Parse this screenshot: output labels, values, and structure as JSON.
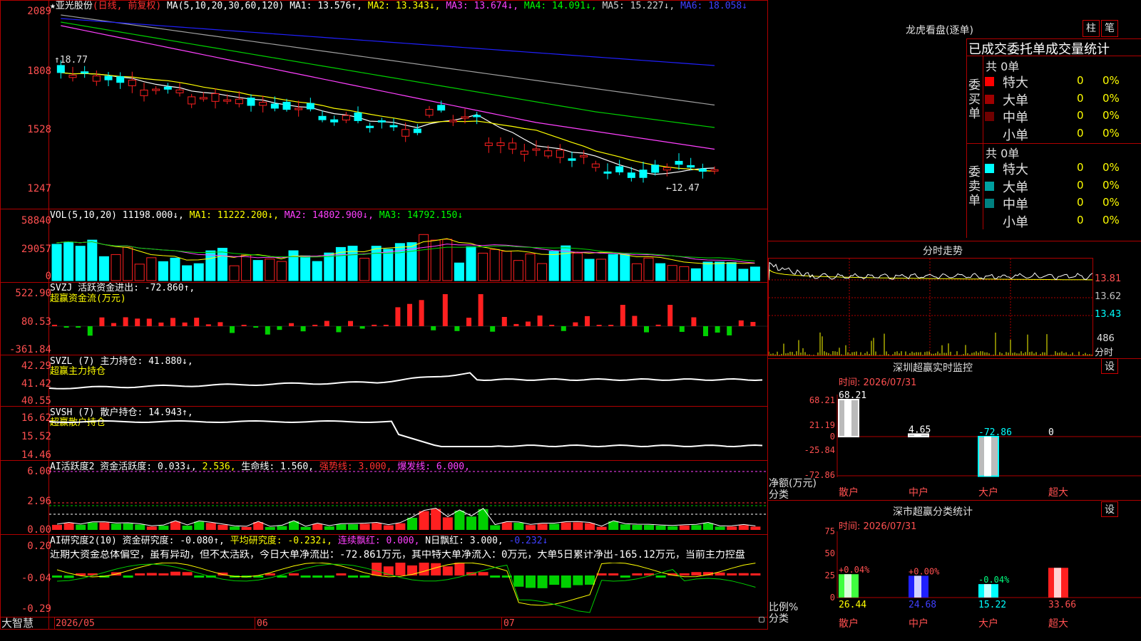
{
  "colors": {
    "up": "#ff2020",
    "down": "#00ffff",
    "frame": "#b00000",
    "axis_text": "#ff5050",
    "yellow": "#ffff00",
    "magenta": "#ff40ff",
    "green": "#00d000",
    "blue": "#2020ff",
    "white": "#ffffff",
    "gray": "#a0a0a0"
  },
  "kline": {
    "title_star": "★",
    "stock_name": "亚光股份",
    "mode": "(日线, 前复权)",
    "ma_def": "MA(5,10,20,30,60,120)",
    "ma1": "MA1: 13.576↑,",
    "ma2": "MA2: 13.343↓,",
    "ma3": "MA3: 13.674↓,",
    "ma4": "MA4: 14.091↓,",
    "ma5": "MA5: 15.227↓,",
    "ma6": "MA6: 18.058↓",
    "axis": [
      "2089",
      "1808",
      "1528",
      "1247"
    ],
    "high_mark": "18.77",
    "low_mark": "12.47"
  },
  "vol": {
    "label": "VOL(5,10,20)",
    "value": "11198.000↓,",
    "ma1": "MA1: 11222.200↓,",
    "ma2": "MA2: 14802.900↓,",
    "ma3": "MA3: 14792.150↓",
    "axis": [
      "58840",
      "29057",
      "0"
    ]
  },
  "svzj": {
    "label": "SVZJ  活跃资金进出: -72.860↑,",
    "sub": "超赢资金流(万元)",
    "axis": [
      "522.90",
      "80.53",
      "-361.84"
    ]
  },
  "svzl": {
    "label": "SVZL (7) 主力持仓: 41.880↓,",
    "sub": "超赢主力持仓",
    "axis": [
      "42.29",
      "41.42",
      "40.55"
    ]
  },
  "svsh": {
    "label": "SVSH (7) 散户持仓: 14.943↑,",
    "sub": "超赢散户持仓",
    "axis": [
      "16.62",
      "15.52",
      "14.46"
    ]
  },
  "ai1": {
    "label": "AI活跃度2 资金活跃度: 0.033↓,",
    "v2": "2.536,",
    "life": "生命线: 1.560,",
    "strong": "强势线: 3.000,",
    "burst": "爆发线: 6.000,",
    "axis": [
      "6.00",
      "2.96",
      "0.00"
    ]
  },
  "ai2": {
    "label": "AI研究度2(10) 资金研究度: -0.080↑,",
    "avg": "平均研究度: -0.232↓,",
    "cont": "连续飘红: 0.000,",
    "nday": "N日飘红: 3.000,",
    "last": "-0.232↓",
    "note": "近期大资金总体偏空，虽有异动，但不太活跃，今日大单净流出：-72.861万元，其中特大单净流入：0万元，大单5日累计净出-165.12万元，当前主力控盘",
    "axis": [
      "0.20",
      "-0.04",
      "-0.29"
    ]
  },
  "bottom": {
    "brand": "大智慧",
    "dates": [
      "2026/05",
      "06",
      "07"
    ]
  },
  "right": {
    "dragon_title": "龙虎看盘(逐单)",
    "btn_a": "柱",
    "btn_b": "笔",
    "tabs": "已成交委托单成交量统计",
    "buy_label": "委买单",
    "buy_total": "共 0单",
    "sell_label": "委卖单",
    "sell_total": "共 0单",
    "buy_rows": [
      {
        "name": "特大",
        "v": "0",
        "p": "0%",
        "c": "#ff0000"
      },
      {
        "name": "大单",
        "v": "0",
        "p": "0%",
        "c": "#a00000"
      },
      {
        "name": "中单",
        "v": "0",
        "p": "0%",
        "c": "#700000"
      },
      {
        "name": "小单",
        "v": "0",
        "p": "0%",
        "c": "#000000"
      }
    ],
    "sell_rows": [
      {
        "name": "特大",
        "v": "0",
        "p": "0%",
        "c": "#00ffff"
      },
      {
        "name": "大单",
        "v": "0",
        "p": "0%",
        "c": "#00a0a0"
      },
      {
        "name": "中单",
        "v": "0",
        "p": "0%",
        "c": "#008080"
      },
      {
        "name": "小单",
        "v": "0",
        "p": "0%",
        "c": "#000000"
      }
    ],
    "fenshi_title": "分时走势",
    "fenshi_axis": [
      "13.81",
      "13.62",
      "13.43",
      "486",
      "分时"
    ],
    "monitor_title": "深圳超赢实时监控",
    "monitor_set": "设",
    "monitor_time": "时间: 2026/07/31",
    "monitor_axis": [
      "68.21",
      "21.19",
      "0",
      "-25.84",
      "-72.86"
    ],
    "monitor_y_title": "净额(万元)",
    "monitor_x_title": "分类",
    "monitor_bars": [
      {
        "cat": "散户",
        "label": "68.21",
        "value": 68.21
      },
      {
        "cat": "中户",
        "label": "4.65",
        "value": 4.65
      },
      {
        "cat": "大户",
        "label": "-72.86",
        "value": -72.86
      },
      {
        "cat": "超大",
        "label": "0",
        "value": 0
      }
    ],
    "class_title": "深市超赢分类统计",
    "class_set": "设",
    "class_time": "时间: 2026/07/31",
    "class_axis": [
      "75",
      "50",
      "25",
      "0"
    ],
    "class_y_title": "比例%",
    "class_x_title": "分类",
    "class_bars": [
      {
        "cat": "散户",
        "pct": "+0.04%",
        "val": "26.44",
        "value": 26.44,
        "color": "#40ff40"
      },
      {
        "cat": "中户",
        "pct": "+0.00%",
        "val": "24.68",
        "value": 24.68,
        "color": "#2020ff"
      },
      {
        "cat": "大户",
        "pct": "-0.04%",
        "val": "15.22",
        "value": 15.22,
        "color": "#00ffff"
      },
      {
        "cat": "超大",
        "pct": "",
        "val": "33.66",
        "value": 33.66,
        "color": "#ff2020"
      }
    ]
  }
}
